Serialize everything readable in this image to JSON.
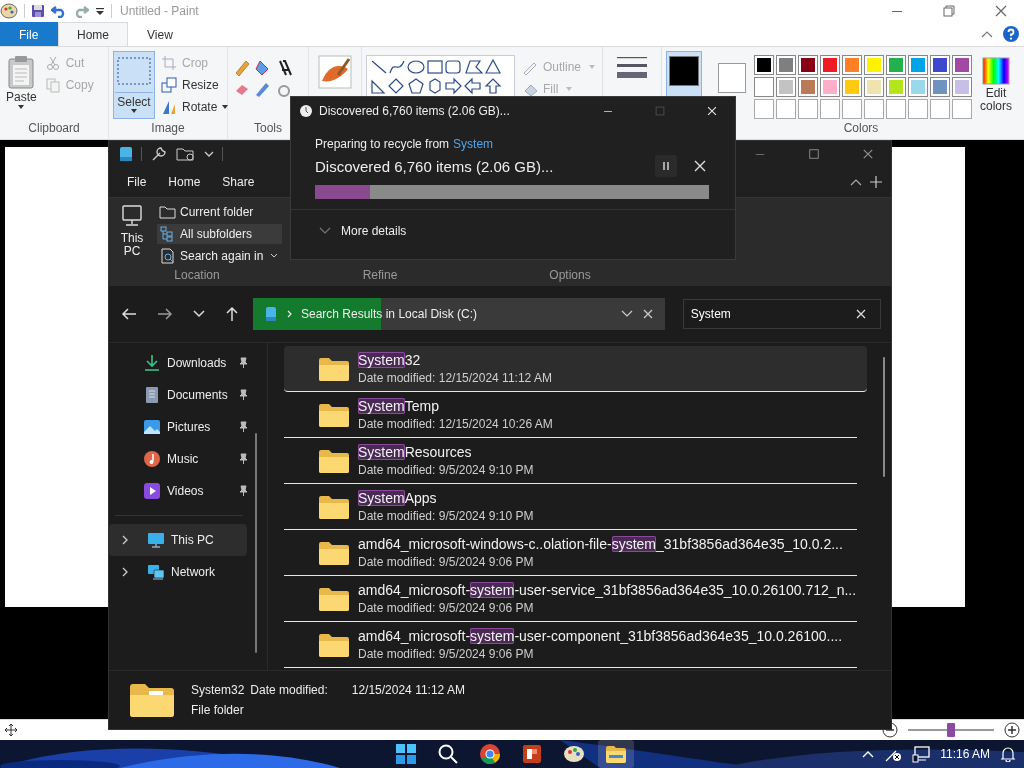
{
  "paint": {
    "title": "Untitled - Paint",
    "tabs": [
      {
        "label": "File",
        "kind": "file",
        "selected": false
      },
      {
        "label": "Home",
        "kind": "tab",
        "selected": true
      },
      {
        "label": "View",
        "kind": "tab",
        "selected": false
      }
    ],
    "clipboard": {
      "paste": "Paste",
      "cut": {
        "label": "Cut",
        "disabled": true
      },
      "copy": {
        "label": "Copy",
        "disabled": true
      },
      "label": "Clipboard"
    },
    "image": {
      "select": "Select",
      "crop": {
        "label": "Crop",
        "disabled": true
      },
      "resize": {
        "label": "Resize",
        "disabled": false
      },
      "rotate": {
        "label": "Rotate",
        "disabled": false
      },
      "label": "Image"
    },
    "tools": {
      "label": "Tools"
    },
    "shapes": {
      "outline": {
        "label": "Outline",
        "disabled": true
      },
      "fill": {
        "label": "Fill",
        "disabled": true
      }
    },
    "colors": {
      "label": "Colors",
      "edit": "Edit colors",
      "color_1": {
        "color": "#000000"
      },
      "color_2": {
        "color": "#ffffff"
      },
      "palette": [
        {
          "color": "#000000"
        },
        {
          "color": "#7f7f7f"
        },
        {
          "color": "#880015"
        },
        {
          "color": "#ed1c24"
        },
        {
          "color": "#ff7f27"
        },
        {
          "color": "#fff200"
        },
        {
          "color": "#22b14c"
        },
        {
          "color": "#00a2e8"
        },
        {
          "color": "#3f48cc"
        },
        {
          "color": "#a349a4"
        },
        {
          "color": "#ffffff"
        },
        {
          "color": "#c3c3c3"
        },
        {
          "color": "#b97a57"
        },
        {
          "color": "#ffaec9"
        },
        {
          "color": "#ffc90e"
        },
        {
          "color": "#efe4b0"
        },
        {
          "color": "#b5e61d"
        },
        {
          "color": "#99d9ea"
        },
        {
          "color": "#7092be"
        },
        {
          "color": "#c8bfe7"
        }
      ]
    },
    "zoom": {
      "level": 0.5
    }
  },
  "explorer": {
    "menu": [
      {
        "label": "File"
      },
      {
        "label": "Home"
      },
      {
        "label": "Share"
      }
    ],
    "ribbon": {
      "this_pc": "This PC",
      "current_folder": {
        "label": "Current folder",
        "selected": false
      },
      "all_subfolders": {
        "label": "All subfolders",
        "selected": true
      },
      "search_again": "Search again in",
      "groups": [
        "Location",
        "Refine",
        "Options"
      ]
    },
    "address": {
      "text": "Search Results in Local Disk (C:)",
      "level": 0.31
    },
    "search": {
      "value": "System"
    },
    "quick_access": [
      {
        "label": "Downloads",
        "kind": "download",
        "pinned": true
      },
      {
        "label": "Documents",
        "kind": "document",
        "pinned": true
      },
      {
        "label": "Pictures",
        "kind": "picture",
        "pinned": true
      },
      {
        "label": "Music",
        "kind": "music",
        "pinned": true
      },
      {
        "label": "Videos",
        "kind": "video",
        "pinned": true
      }
    ],
    "locations": [
      {
        "label": "This PC",
        "kind": "pc",
        "expanded": false,
        "selected": true
      },
      {
        "label": "Network",
        "kind": "network",
        "expanded": false,
        "selected": false
      }
    ],
    "files": [
      {
        "name": [
          {
            "text": "System",
            "highlighted": true
          },
          {
            "text": "32",
            "highlighted": false
          }
        ],
        "modified": "Date modified: 12/15/2024 11:12 AM",
        "selected": true
      },
      {
        "name": [
          {
            "text": "System",
            "highlighted": true
          },
          {
            "text": "Temp",
            "highlighted": false
          }
        ],
        "modified": "Date modified: 12/15/2024 10:26 AM",
        "selected": false
      },
      {
        "name": [
          {
            "text": "System",
            "highlighted": true
          },
          {
            "text": "Resources",
            "highlighted": false
          }
        ],
        "modified": "Date modified: 9/5/2024 9:10 PM",
        "selected": false
      },
      {
        "name": [
          {
            "text": "System",
            "highlighted": true
          },
          {
            "text": "Apps",
            "highlighted": false
          }
        ],
        "modified": "Date modified: 9/5/2024 9:10 PM",
        "selected": false
      },
      {
        "name": [
          {
            "text": "amd64_microsoft-windows-c..olation-file-",
            "highlighted": false
          },
          {
            "text": "system",
            "highlighted": true
          },
          {
            "text": "_31bf3856ad364e35_10.0.2...",
            "highlighted": false
          }
        ],
        "modified": "Date modified: 9/5/2024 9:06 PM",
        "selected": false
      },
      {
        "name": [
          {
            "text": "amd64_microsoft-",
            "highlighted": false
          },
          {
            "text": "system",
            "highlighted": true
          },
          {
            "text": "-user-service_31bf3856ad364e35_10.0.26100.712_n...",
            "highlighted": false
          }
        ],
        "modified": "Date modified: 9/5/2024 9:06 PM",
        "selected": false
      },
      {
        "name": [
          {
            "text": "amd64_microsoft-",
            "highlighted": false
          },
          {
            "text": "system",
            "highlighted": true
          },
          {
            "text": "-user-component_31bf3856ad364e35_10.0.26100....",
            "highlighted": false
          }
        ],
        "modified": "Date modified: 9/5/2024 9:06 PM",
        "selected": false
      }
    ],
    "details": {
      "name": "System32",
      "date_label": "Date modified:",
      "date": "12/15/2024 11:12 AM",
      "type": "File folder"
    }
  },
  "dialog": {
    "title": "Discovered 6,760 items (2.06 GB)...",
    "prefix": "Preparing to recycle from",
    "source": "System",
    "status": "Discovered 6,760 items (2.06 GB)...",
    "level": 0.14,
    "more": "More details"
  },
  "taskbar": {
    "apps": [
      {
        "kind": "start",
        "active": false
      },
      {
        "kind": "search",
        "active": false
      },
      {
        "kind": "browser",
        "active": false
      },
      {
        "kind": "slides",
        "active": false
      },
      {
        "kind": "paint",
        "active": false
      },
      {
        "kind": "explorer",
        "active": true
      }
    ],
    "time": "11:16 AM"
  }
}
